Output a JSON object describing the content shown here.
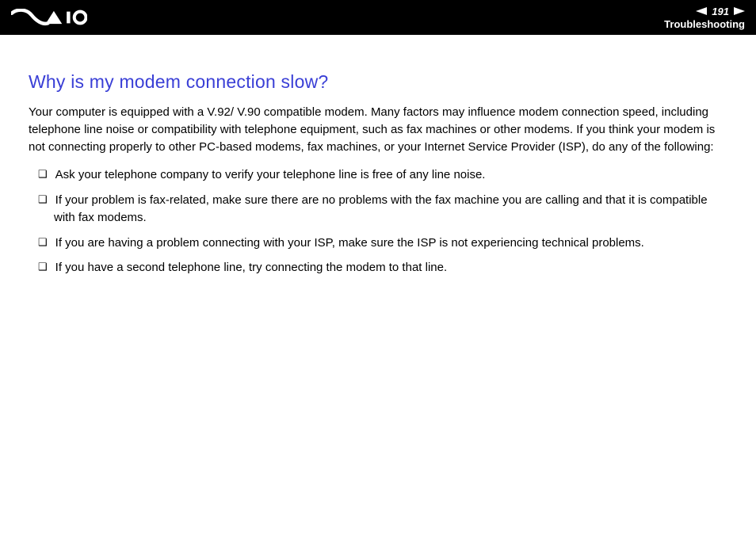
{
  "header": {
    "logo_brand": "VAIO",
    "page_number": "191",
    "section": "Troubleshooting"
  },
  "article": {
    "title": "Why is my modem connection slow?",
    "intro": "Your computer is equipped with a V.92/ V.90 compatible modem. Many factors may influence modem connection speed, including telephone line noise or compatibility with telephone equipment, such as fax machines or other modems. If you think your modem is not connecting properly to other PC-based modems, fax machines, or your Internet Service Provider (ISP), do any of the following:",
    "bullets": [
      "Ask your telephone company to verify your telephone line is free of any line noise.",
      "If your problem is fax-related, make sure there are no problems with the fax machine you are calling and that it is compatible with fax modems.",
      "If you are having a problem connecting with your ISP, make sure the ISP is not experiencing technical problems.",
      "If you have a second telephone line, try connecting the modem to that line."
    ]
  }
}
